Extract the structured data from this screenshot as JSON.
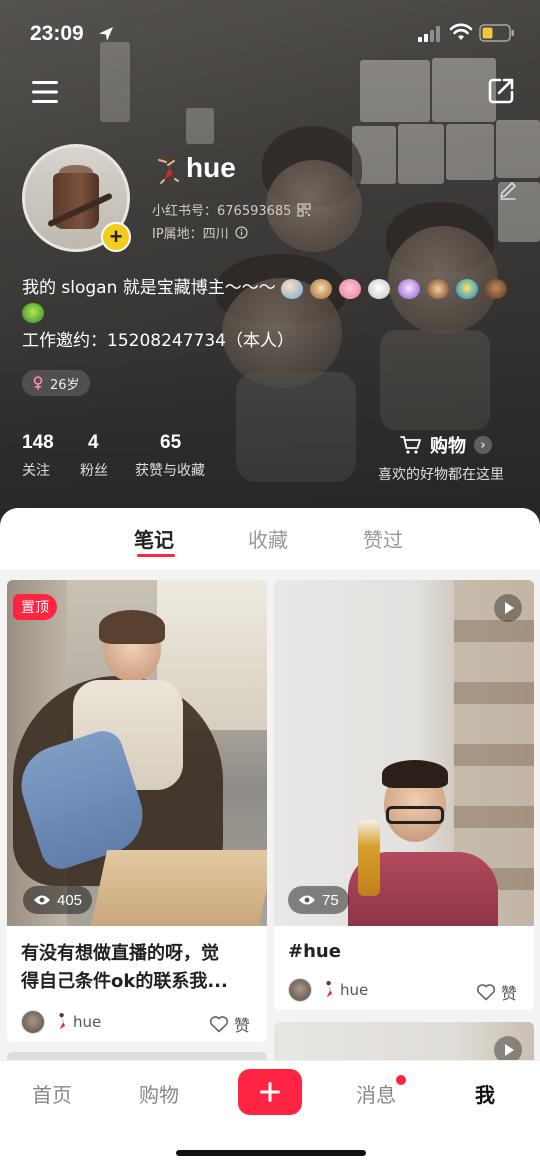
{
  "status_bar": {
    "time": "23:09",
    "icons": [
      "location-arrow-icon",
      "signal-icon",
      "wifi-icon",
      "battery-icon"
    ]
  },
  "header": {
    "menu_icon": "hamburger-menu-icon",
    "share_icon": "share-icon"
  },
  "profile": {
    "nickname": "hue",
    "nickname_emoji": "dancer-emoji",
    "redbook_id": "小红书号：676593685",
    "ip_location": "IP属地：四川",
    "bio_line1": "我的 slogan 就是宝藏博主～～～",
    "bio_emojis": [
      "fairy",
      "dog",
      "pig",
      "rabbit",
      "unicorn",
      "monkey",
      "fish",
      "ox",
      "parrot"
    ],
    "bio_line2": "工作邀约：15208247734（本人）",
    "age": "26岁",
    "stats": [
      {
        "value": "148",
        "label": "关注"
      },
      {
        "value": "4",
        "label": "粉丝"
      },
      {
        "value": "65",
        "label": "获赞与收藏"
      }
    ],
    "shop": {
      "title": "购物",
      "subtitle": "喜欢的好物都在这里"
    }
  },
  "tabs": [
    {
      "label": "笔记",
      "active": true
    },
    {
      "label": "收藏",
      "active": false
    },
    {
      "label": "赞过",
      "active": false
    }
  ],
  "notes": [
    {
      "pinned_label": "置顶",
      "views": "405",
      "title_line1": "有没有想做直播的呀，觉",
      "title_line2": "得自己条件ok的联系我...",
      "author": "hue",
      "like_label": "赞"
    },
    {
      "views": "75",
      "is_video": true,
      "title_line1": "#hue",
      "author": "hue",
      "like_label": "赞"
    }
  ],
  "bottom_nav": [
    {
      "label": "首页",
      "active": false
    },
    {
      "label": "购物",
      "active": false
    },
    {
      "label": "消息",
      "active": false,
      "badge": true
    },
    {
      "label": "我",
      "active": true
    }
  ],
  "colors": {
    "accent": "#ff2442",
    "avatar_add": "#f3cc1e"
  }
}
